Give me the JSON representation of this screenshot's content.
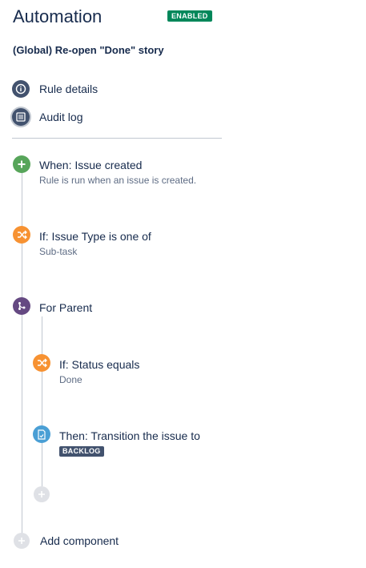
{
  "header": {
    "title": "Automation",
    "status": "ENABLED",
    "rule_name": "(Global) Re-open \"Done\" story"
  },
  "nav": {
    "rule_details": "Rule details",
    "audit_log": "Audit log"
  },
  "components": {
    "trigger": {
      "title": "When: Issue created",
      "subtitle": "Rule is run when an issue is created."
    },
    "condition1": {
      "title": "If: Issue Type is one of",
      "subtitle": "Sub-task"
    },
    "branch": {
      "title": "For Parent"
    },
    "condition2": {
      "title": "If: Status equals",
      "subtitle": "Done"
    },
    "action": {
      "title": "Then: Transition the issue to",
      "badge": "BACKLOG"
    },
    "add_component": "Add component"
  },
  "colors": {
    "enabled": "#00875a",
    "trigger": "#57a55a",
    "condition": "#f79232",
    "branch": "#654982",
    "action": "#4a9fd5",
    "nav_icon": "#42526e"
  }
}
